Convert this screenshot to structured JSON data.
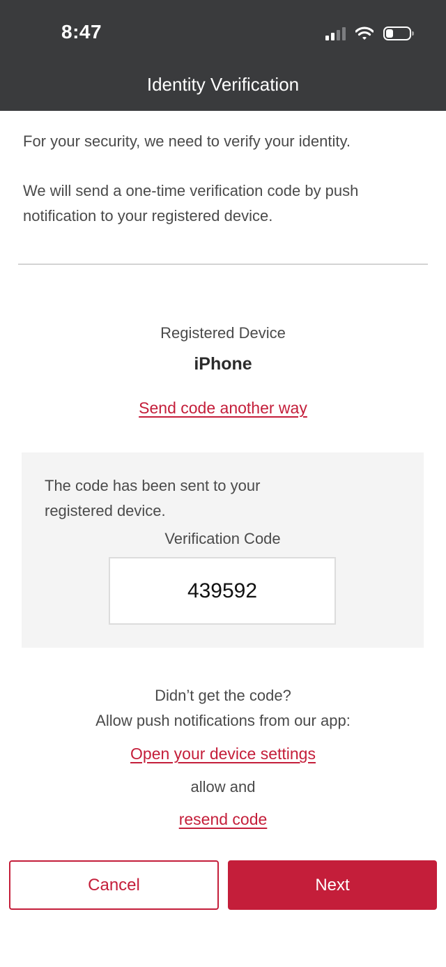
{
  "status_bar": {
    "time": "8:47",
    "icons": [
      "cellular-signal-icon",
      "wifi-icon",
      "battery-icon"
    ],
    "battery_level": 0.3
  },
  "header": {
    "title": "Identity Verification"
  },
  "intro": {
    "line1": "For your security, we need to verify your identity.",
    "line2": "We will send a one-time verification code by push notification to your registered device."
  },
  "device": {
    "label": "Registered Device",
    "name": "iPhone",
    "alt_link": "Send code another way"
  },
  "code_panel": {
    "message": "The code has been sent to your registered device.",
    "code_label": "Verification Code",
    "code_value": "439592"
  },
  "help": {
    "line1": "Didn’t get the code?",
    "line2": "Allow push notifications from our app:",
    "settings_link": "Open your device settings",
    "middle": "allow and",
    "resend_link": "resend code"
  },
  "actions": {
    "cancel": "Cancel",
    "next": "Next"
  },
  "colors": {
    "header_bg": "#3a3b3d",
    "accent": "#c41e3a",
    "panel_bg": "#f4f4f4",
    "text": "#4a4a4a"
  }
}
